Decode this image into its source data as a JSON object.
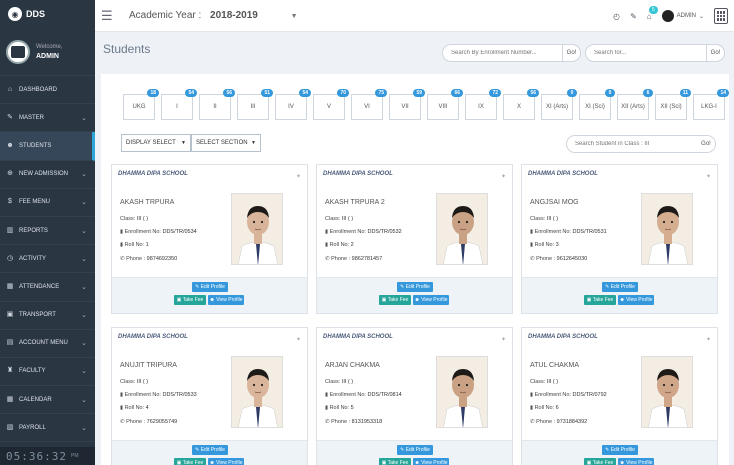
{
  "brand": {
    "name": "DDS"
  },
  "user": {
    "welcome": "Welcome,",
    "name": "ADMIN"
  },
  "menu": [
    {
      "label": "DASHBOARD",
      "icon": "home-icon",
      "chevron": false
    },
    {
      "label": "Master",
      "icon": "edit-icon",
      "chevron": true
    },
    {
      "label": "STUDENTS",
      "icon": "users-icon",
      "chevron": false,
      "active": true
    },
    {
      "label": "NEW ADMISSION",
      "icon": "plus-icon",
      "chevron": true
    },
    {
      "label": "FEE MENU",
      "icon": "dollar-icon",
      "chevron": true
    },
    {
      "label": "REPORTS",
      "icon": "chart-icon",
      "chevron": true
    },
    {
      "label": "ACTIVITY",
      "icon": "activity-icon",
      "chevron": true
    },
    {
      "label": "ATTENDANCE",
      "icon": "calendar-check-icon",
      "chevron": true
    },
    {
      "label": "TRANSPORT",
      "icon": "bus-icon",
      "chevron": true
    },
    {
      "label": "ACCOUNT MENU",
      "icon": "account-icon",
      "chevron": true
    },
    {
      "label": "FACULTY",
      "icon": "faculty-icon",
      "chevron": true
    },
    {
      "label": "CALENDAR",
      "icon": "calendar-icon",
      "chevron": true
    },
    {
      "label": "PAYROLL",
      "icon": "payroll-icon",
      "chevron": true
    }
  ],
  "clock": {
    "time": "05:36:32",
    "ampm": "PM"
  },
  "header": {
    "academic_label": "Academic Year :",
    "academic_year": "2018-2019",
    "notification_count": "5",
    "admin_label": "ADMIN"
  },
  "page": {
    "title": "Students"
  },
  "search": {
    "enrollment_placeholder": "Search By Enrollment Number...",
    "go": "Go!",
    "general_placeholder": "Search for...",
    "class_placeholder": "Search Student in Class : III"
  },
  "classes": [
    {
      "label": "UKG",
      "count": "18"
    },
    {
      "label": "I",
      "count": "54"
    },
    {
      "label": "II",
      "count": "56"
    },
    {
      "label": "III",
      "count": "51"
    },
    {
      "label": "IV",
      "count": "54"
    },
    {
      "label": "V",
      "count": "70"
    },
    {
      "label": "VI",
      "count": "75"
    },
    {
      "label": "VII",
      "count": "59"
    },
    {
      "label": "VIII",
      "count": "66"
    },
    {
      "label": "IX",
      "count": "72"
    },
    {
      "label": "X",
      "count": "56"
    },
    {
      "label": "XI (Arts)",
      "count": "0"
    },
    {
      "label": "XI (Sci)",
      "count": "0"
    },
    {
      "label": "XII (Arts)",
      "count": "6"
    },
    {
      "label": "XII (Sci)",
      "count": "11"
    },
    {
      "label": "LKG-I",
      "count": "14"
    }
  ],
  "filters": {
    "display": "DISPLAY SELECT",
    "section": "SELECT SECTION"
  },
  "labels": {
    "class": "Class:",
    "enrollment": "Enrollment No:",
    "roll": "Roll No:",
    "phone": "Phone :",
    "edit": "Edit Profile",
    "fee": "Take Fee",
    "view": "View Profile"
  },
  "students": [
    {
      "school": "DHAMMA DIPA SCHOOL",
      "name": "AKASH TRPURA",
      "class": "III ( )",
      "enrollment": "DDS/TR/0534",
      "roll": "1",
      "phone": "9874692350",
      "shirt": "#ffffff",
      "skin": "#d8b49a"
    },
    {
      "school": "DHAMMA DIPA SCHOOL",
      "name": "AKASH TRPURA 2",
      "class": "III ( )",
      "enrollment": "DDS/TR/0532",
      "roll": "2",
      "phone": "9862781457",
      "shirt": "#ffffff",
      "skin": "#c9a184"
    },
    {
      "school": "DHAMMA DIPA SCHOOL",
      "name": "ANGJSAI MOG",
      "class": "III ( )",
      "enrollment": "DDS/TR/0531",
      "roll": "3",
      "phone": "9612645030",
      "shirt": "#ffffff",
      "skin": "#d5ae90"
    },
    {
      "school": "DHAMMA DIPA SCHOOL",
      "name": "ANUJIT TRIPURA",
      "class": "III ( )",
      "enrollment": "DDS/TR/0533",
      "roll": "4",
      "phone": "7629055749",
      "shirt": "#ffffff",
      "skin": "#d9b59b"
    },
    {
      "school": "DHAMMA DIPA SCHOOL",
      "name": "ARJAN CHAKMA",
      "class": "III ( )",
      "enrollment": "DDS/TR/0814",
      "roll": "5",
      "phone": "8131953318",
      "shirt": "#ffffff",
      "skin": "#caa283"
    },
    {
      "school": "DHAMMA DIPA SCHOOL",
      "name": "ATUL CHAKMA",
      "class": "III ( )",
      "enrollment": "DDS/TR/0792",
      "roll": "6",
      "phone": "9731884392",
      "shirt": "#ffffff",
      "skin": "#d0a688"
    }
  ]
}
